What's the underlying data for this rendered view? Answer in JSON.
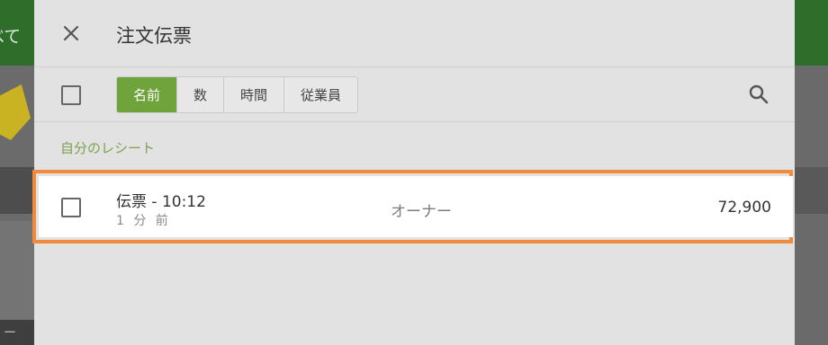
{
  "background": {
    "topbar_text": "べて",
    "bottom_left_text": "ー"
  },
  "modal": {
    "title": "注文伝票",
    "close_icon": "close-icon",
    "search_icon": "search-icon",
    "sort_tabs": [
      {
        "label": "名前",
        "active": true
      },
      {
        "label": "数",
        "active": false
      },
      {
        "label": "時間",
        "active": false
      },
      {
        "label": "従業員",
        "active": false
      }
    ],
    "section_label": "自分のレシート",
    "receipts": [
      {
        "title": "伝票 - 10:12",
        "age": "1 分 前",
        "employee": "オーナー",
        "amount": "72,900",
        "checked": false,
        "highlighted": true
      }
    ]
  },
  "colors": {
    "accent": "#6fa33b",
    "highlight": "#f08a3c",
    "topbar": "#2e6e2a"
  }
}
